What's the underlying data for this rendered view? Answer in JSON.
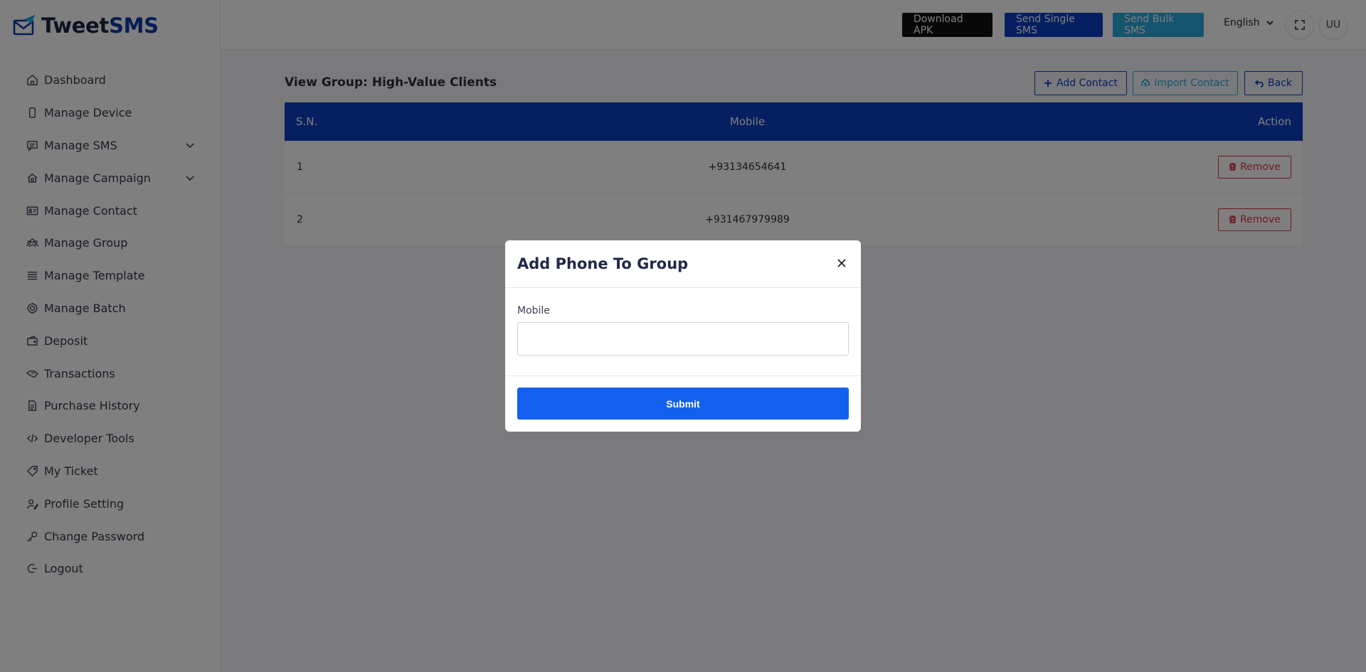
{
  "brand": {
    "name_part1": "Tweet",
    "name_part2": "SMS"
  },
  "sidebar": {
    "items": [
      {
        "label": "Dashboard",
        "icon": "home-icon"
      },
      {
        "label": "Manage Device",
        "icon": "phone-icon"
      },
      {
        "label": "Manage SMS",
        "icon": "message-icon",
        "has_submenu": true
      },
      {
        "label": "Manage Campaign",
        "icon": "campaign-icon",
        "has_submenu": true
      },
      {
        "label": "Manage Contact",
        "icon": "contact-card-icon"
      },
      {
        "label": "Manage Group",
        "icon": "group-icon"
      },
      {
        "label": "Manage Template",
        "icon": "list-icon"
      },
      {
        "label": "Manage Batch",
        "icon": "batch-icon"
      },
      {
        "label": "Deposit",
        "icon": "wallet-icon"
      },
      {
        "label": "Transactions",
        "icon": "transactions-icon"
      },
      {
        "label": "Purchase History",
        "icon": "document-icon"
      },
      {
        "label": "Developer Tools",
        "icon": "code-icon"
      },
      {
        "label": "My Ticket",
        "icon": "ticket-icon"
      },
      {
        "label": "Profile Setting",
        "icon": "user-settings-icon"
      },
      {
        "label": "Change Password",
        "icon": "key-icon"
      },
      {
        "label": "Logout",
        "icon": "logout-icon"
      }
    ]
  },
  "topbar": {
    "download_apk": "Download APK",
    "send_single": "Send Single SMS",
    "send_bulk": "Send Bulk SMS",
    "language": "English",
    "avatar_initials": "UU"
  },
  "main": {
    "title": "View Group: High-Value Clients",
    "add_contact": "Add Contact",
    "import_contact": "Import Contact",
    "back": "Back",
    "table": {
      "headers": {
        "sn": "S.N.",
        "mobile": "Mobile",
        "action": "Action"
      },
      "rows": [
        {
          "sn": "1",
          "mobile": "+93134654641",
          "action": "Remove"
        },
        {
          "sn": "2",
          "mobile": "+931467979989",
          "action": "Remove"
        }
      ]
    }
  },
  "modal": {
    "title": "Add Phone To Group",
    "mobile_label": "Mobile",
    "mobile_value": "",
    "submit": "Submit"
  },
  "colors": {
    "primary": "#0c3ec4",
    "info": "#2aa9df",
    "danger": "#dc3545",
    "submit": "#1360f0",
    "dark": "#111111"
  }
}
